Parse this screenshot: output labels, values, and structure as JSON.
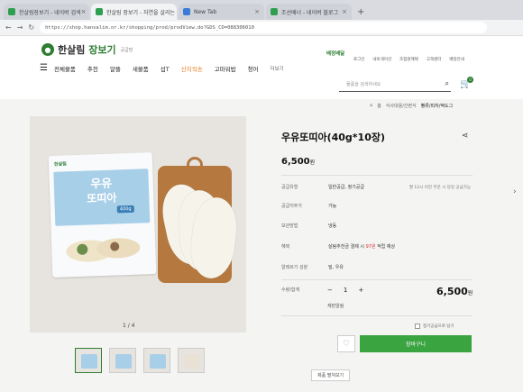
{
  "browser": {
    "tabs": [
      {
        "title": "한살림장보기 - 네이버 검색",
        "active": false
      },
      {
        "title": "한살림 장보기 - 자연을 살리는 먹거리",
        "active": true
      },
      {
        "title": "New Tab",
        "active": false
      },
      {
        "title": "조선배너 - 네이버 블로그",
        "active": false
      }
    ],
    "new_tab_label": "+",
    "url": "https://shop.hansalim.or.kr/shopping/prod/prodView.do?GDS_CD=088306010"
  },
  "header": {
    "logo_text_1": "한살림",
    "logo_text_2": "장보기",
    "logo_sub": "공급망",
    "delivery_label": "배정배달",
    "util_links": [
      "로그인",
      "내비게이션",
      "조합원혜택",
      "고객센터",
      "배달안내"
    ],
    "menu": [
      {
        "label": "전체물품",
        "style": ""
      },
      {
        "label": "추천",
        "style": ""
      },
      {
        "label": "알뜰",
        "style": ""
      },
      {
        "label": "새물품",
        "style": ""
      },
      {
        "label": "섭T",
        "style": ""
      },
      {
        "label": "산지직송",
        "style": "orange"
      },
      {
        "label": "고마워밥",
        "style": ""
      },
      {
        "label": "청어",
        "style": ""
      },
      {
        "label": "더보기",
        "style": "small"
      }
    ],
    "search_placeholder": "물품을 검색하세요",
    "cart_count": "0"
  },
  "breadcrumb": [
    "홈",
    "식사대용/간편식",
    "빵류/피자/떡도그"
  ],
  "product": {
    "title": "우유또띠아(40g*10장)",
    "price": "6,500",
    "price_unit": "원",
    "image_counter": "1 / 4",
    "package_brand": "한살림",
    "package_title_1": "우유",
    "package_title_2": "또띠아",
    "package_weight": "400g",
    "info": [
      {
        "label": "공급유형",
        "value": "일반공급, 정기공급",
        "extra": "월 12시 이전 주문 시 당일 공급가능"
      },
      {
        "label": "공급지주가",
        "value": "가능",
        "extra": ""
      },
      {
        "label": "보관방법",
        "value": "냉동",
        "extra": ""
      },
      {
        "label": "혜택",
        "value_prefix": "살림추천금 결제 시 ",
        "value_highlight": "97원",
        "value_suffix": " 적립 예상",
        "extra": ""
      },
      {
        "label": "알레르기 성분",
        "value": "밀, 우유",
        "extra": ""
      }
    ],
    "quantity_label": "수량/합계",
    "qty_minus": "−",
    "qty_value": "1",
    "qty_plus": "+",
    "total_price": "6,500",
    "total_unit": "원",
    "reserve_label": "재판알림",
    "subscribe_label": "정기공급으로 담기",
    "wish_icon": "heart-icon",
    "cart_button": "장바구니",
    "more_button": "제품 펼쳐보기"
  }
}
